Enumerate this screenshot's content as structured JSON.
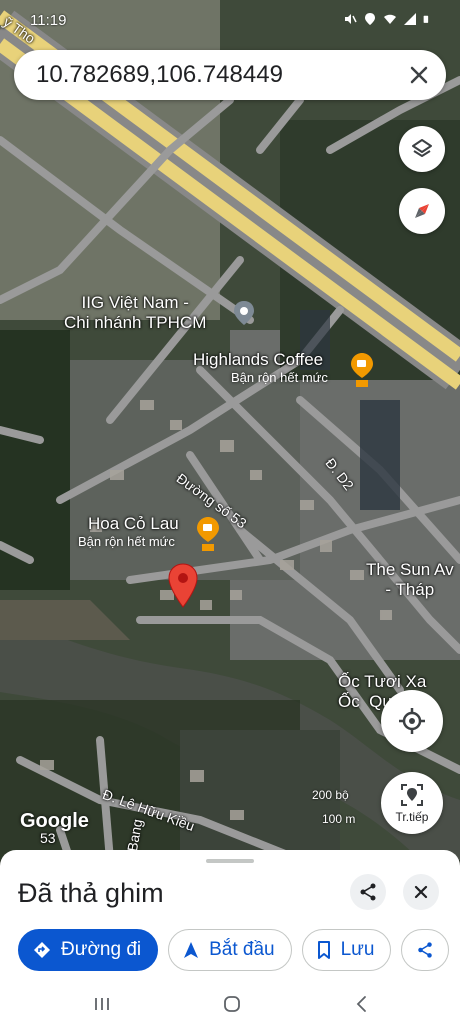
{
  "status_bar": {
    "time": "11:19"
  },
  "search": {
    "value": "10.782689,106.748449"
  },
  "map": {
    "road_top_left": "ỹ Tho",
    "poi_iig": "IIG Việt Nam -\nChi nhánh TPHCM",
    "poi_highlands_name": "Highlands Coffee",
    "poi_highlands_sub": "Bận rộn hết mức",
    "road_53": "Đường số 53",
    "road_d2": "Đ. D2",
    "poi_hoacolau_name": "Hoa Cỏ Lau",
    "poi_hoacolau_sub": "Bận rộn hết mức",
    "poi_sun": "The Sun Av\n- Tháp",
    "poi_oc": "Ốc Tươi Xa\nỐc  Quá",
    "road_lehuukieu": "Đ. Lê Hữu Kiều",
    "road_bang": "Bang",
    "road_53b": "53",
    "scale_200": "200 bộ",
    "scale_100": "100 m",
    "google_logo": "Google"
  },
  "buttons": {
    "nav_label": "Tr.tiếp"
  },
  "sheet": {
    "title": "Đã thả ghim",
    "chips": [
      {
        "label": "Đường đi"
      },
      {
        "label": "Bắt đầu"
      },
      {
        "label": "Lưu"
      }
    ]
  },
  "colors": {
    "accent": "#0b57d0",
    "pin_red": "#ea4335",
    "poi_orange": "#f29900",
    "highway_yellow": "#e8d27a"
  }
}
